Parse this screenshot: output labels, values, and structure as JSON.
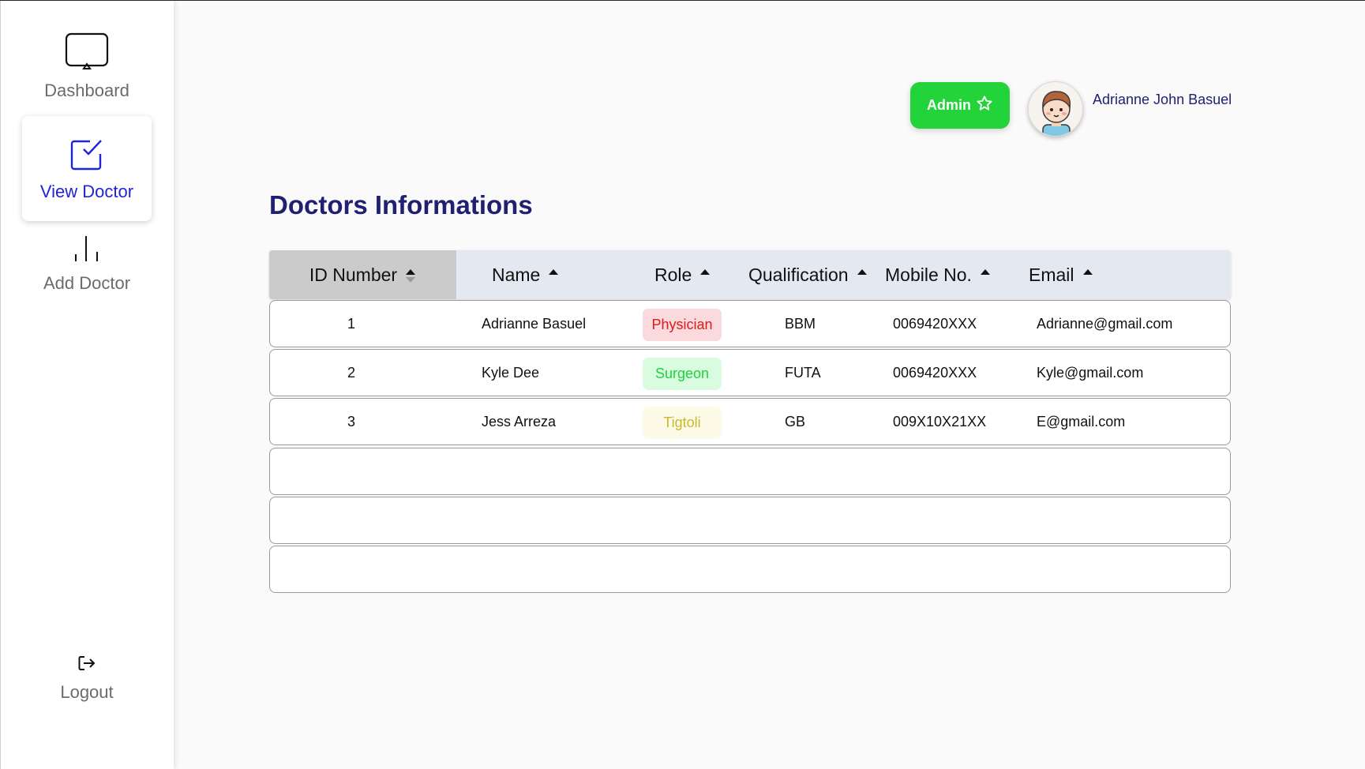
{
  "sidebar": {
    "items": [
      {
        "label": "Dashboard",
        "icon": "tv-icon"
      },
      {
        "label": "View Doctor",
        "icon": "checkbox-icon",
        "active": true
      },
      {
        "label": "Add Doctor",
        "icon": "bar-chart-icon"
      }
    ],
    "logout": {
      "label": "Logout",
      "icon": "logout-icon"
    }
  },
  "header": {
    "role_button": "Admin",
    "user_name": "Adrianne John Basuel"
  },
  "page": {
    "title": "Doctors Informations"
  },
  "table": {
    "columns": [
      "ID Number",
      "Name",
      "Role",
      "Qualification",
      "Mobile No.",
      "Email"
    ],
    "rows": [
      {
        "id": "1",
        "name": "Adrianne Basuel",
        "role": "Physician",
        "qualification": "BBM",
        "mobile": "0069420XXX",
        "email": "Adrianne@gmail.com"
      },
      {
        "id": "2",
        "name": "Kyle Dee",
        "role": "Surgeon",
        "qualification": "FUTA",
        "mobile": "0069420XXX",
        "email": "Kyle@gmail.com"
      },
      {
        "id": "3",
        "name": "Jess Arreza",
        "role": "Tigtoli",
        "qualification": "GB",
        "mobile": "009X10X21XX",
        "email": "E@gmail.com"
      }
    ]
  },
  "colors": {
    "accent": "#1f24d6",
    "title": "#1f2170",
    "admin_green": "#22d43a",
    "physician_bg": "#fadadd",
    "physician_fg": "#e01919",
    "surgeon_bg": "#d9fbe0",
    "surgeon_fg": "#1bd43a",
    "tigtoli_bg": "#fdfbe8",
    "tigtoli_fg": "#c9b829"
  }
}
